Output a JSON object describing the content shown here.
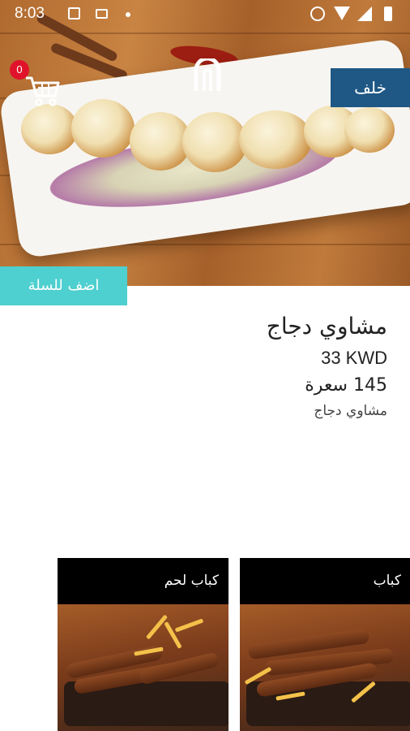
{
  "status_bar": {
    "time": "8:03"
  },
  "header": {
    "cart_badge": "0",
    "back_label": "خلف"
  },
  "product": {
    "add_to_cart_label": "اضف للسلة",
    "name": "مشاوي دجاج",
    "price": "33 KWD",
    "calories": "145 سعرة",
    "description": "مشاوي دجاج"
  },
  "related": [
    {
      "title": "كباب لحم"
    },
    {
      "title": "كباب"
    }
  ],
  "colors": {
    "back_button": "#1f5785",
    "add_to_cart": "#4ecfd0",
    "badge": "#e0132a"
  },
  "icons": [
    "cart-icon",
    "logo-icon",
    "image-icon",
    "card-icon",
    "alarm-icon",
    "wifi-icon",
    "signal-icon",
    "battery-icon"
  ]
}
